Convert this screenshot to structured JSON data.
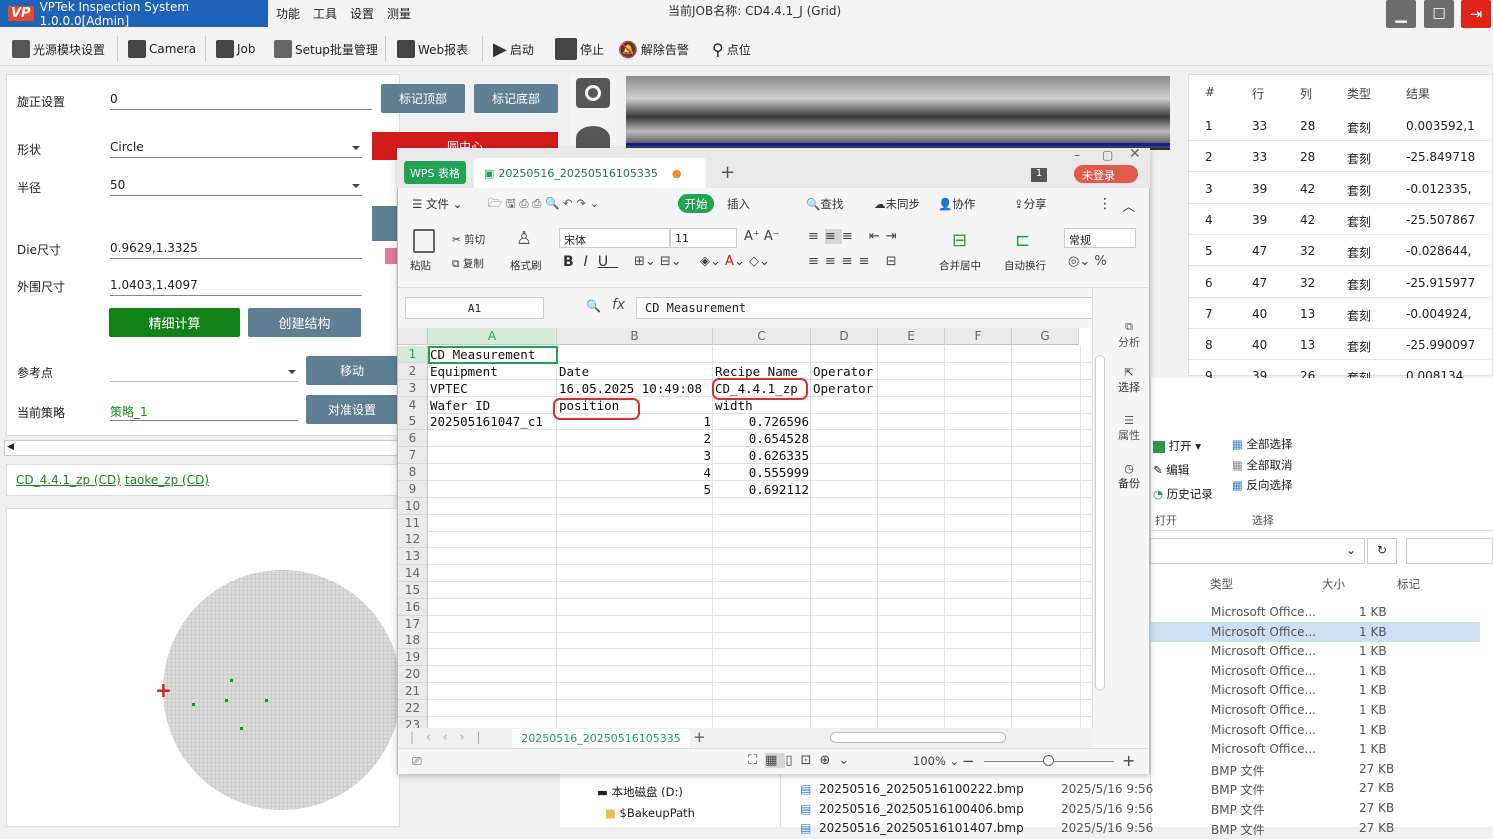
{
  "app": {
    "title": "VPTek Inspection System 1.0.0.0[Admin]",
    "logo": "VP",
    "menu": [
      "功能",
      "工具",
      "设置",
      "测量"
    ],
    "job_label": "当前JOB名称:",
    "job_name": "CD4.4.1_J (Grid)"
  },
  "toolbar": [
    {
      "label": "光源模块设置",
      "icon": "light-icon"
    },
    {
      "label": "Camera",
      "icon": "camera-icon"
    },
    {
      "label": "Job",
      "icon": "briefcase-icon"
    },
    {
      "label": "Setup批量管理",
      "icon": "list-icon"
    },
    {
      "label": "Web报表",
      "icon": "monitor-icon"
    },
    {
      "label": "启动",
      "icon": "play-icon"
    },
    {
      "label": "停止",
      "icon": "stop-icon"
    },
    {
      "label": "解除告警",
      "icon": "bell-off-icon"
    },
    {
      "label": "点位",
      "icon": "pin-icon"
    }
  ],
  "settings": {
    "rotation_label": "旋正设置",
    "rotation_value": "0",
    "mark_top": "标记顶部",
    "mark_bottom": "标记底部",
    "shape_label": "形状",
    "shape_value": "Circle",
    "find_center": "圆中心",
    "radius_label": "半径",
    "radius_value": "50",
    "die_label": "Die尺寸",
    "die_value": "0.9629,1.3325",
    "outer_label": "外围尺寸",
    "outer_value": "1.0403,1.4097",
    "fine_calc": "精细计算",
    "create_struct": "创建结构",
    "ref_label": "参考点",
    "move": "移动",
    "strategy_label": "当前策略",
    "strategy_value": "策略_1",
    "align_settings": "对准设置"
  },
  "cd_tabs": [
    "CD_4.4.1_zp (CD)",
    "taoke_zp (CD)"
  ],
  "results": {
    "headers": [
      "#",
      "行",
      "列",
      "类型",
      "结果"
    ],
    "rows": [
      [
        "1",
        "33",
        "28",
        "套刻",
        "0.003592,1"
      ],
      [
        "2",
        "33",
        "28",
        "套刻",
        "-25.849718"
      ],
      [
        "3",
        "39",
        "42",
        "套刻",
        "-0.012335,"
      ],
      [
        "4",
        "39",
        "42",
        "套刻",
        "-25.507867"
      ],
      [
        "5",
        "47",
        "32",
        "套刻",
        "-0.028644,"
      ],
      [
        "6",
        "47",
        "32",
        "套刻",
        "-25.915977"
      ],
      [
        "7",
        "40",
        "13",
        "套刻",
        "-0.004924,"
      ],
      [
        "8",
        "40",
        "13",
        "套刻",
        "-25.990097"
      ],
      [
        "9",
        "39",
        "26",
        "套刻",
        "0.008134"
      ]
    ]
  },
  "explorer": {
    "ribbon": {
      "open": "打开",
      "edit": "编辑",
      "history": "历史记录",
      "select_all": "全部选择",
      "select_none": "全部取消",
      "invert": "反向选择",
      "group_open": "打开",
      "group_select": "选择"
    },
    "headers": [
      "类型",
      "大小",
      "标记"
    ],
    "rows": [
      [
        "Microsoft Office...",
        "1 KB"
      ],
      [
        "Microsoft Office...",
        "1 KB"
      ],
      [
        "Microsoft Office...",
        "1 KB"
      ],
      [
        "Microsoft Office...",
        "1 KB"
      ],
      [
        "Microsoft Office...",
        "1 KB"
      ],
      [
        "Microsoft Office...",
        "1 KB"
      ],
      [
        "Microsoft Office...",
        "1 KB"
      ],
      [
        "Microsoft Office...",
        "1 KB"
      ],
      [
        "BMP 文件",
        "27 KB"
      ],
      [
        "BMP 文件",
        "27 KB"
      ],
      [
        "BMP 文件",
        "27 KB"
      ],
      [
        "BMP 文件",
        "27 KB"
      ]
    ],
    "files": [
      {
        "name": "20250516_20250516100222.bmp",
        "date": "2025/5/16 9:56"
      },
      {
        "name": "20250516_20250516100406.bmp",
        "date": "2025/5/16 9:56"
      },
      {
        "name": "20250516_20250516101407.bmp",
        "date": "2025/5/16 9:56"
      }
    ],
    "tree": [
      "本地磁盘 (D:)",
      "$BakeupPath"
    ]
  },
  "wps": {
    "app_tab": "WPS 表格",
    "doc_tab": "20250516_20250516105335",
    "badge": "1",
    "login": "未登录",
    "menu": [
      "文件",
      "开始",
      "插入",
      "查找",
      "未同步",
      "协作",
      "分享"
    ],
    "ribbon": {
      "paste": "粘贴",
      "cut": "剪切",
      "copy": "复制",
      "format_painter": "格式刷",
      "font": "宋体",
      "size": "11",
      "merge": "合并居中",
      "wrap": "自动换行",
      "number_format": "常规"
    },
    "namebox": "A1",
    "formula": "CD Measurement",
    "columns": [
      "A",
      "B",
      "C",
      "D",
      "E",
      "F",
      "G"
    ],
    "rows": [
      "1",
      "2",
      "3",
      "4",
      "5",
      "6",
      "7",
      "8",
      "9",
      "10",
      "11",
      "12",
      "13",
      "14",
      "15",
      "16",
      "17",
      "18",
      "19",
      "20",
      "21",
      "22",
      "23"
    ],
    "cells": {
      "A1": "CD Measurement",
      "A2": "Equipment",
      "B2": "Date",
      "C2": "Recipe Name",
      "D2": "Operator",
      "A3": "VPTEC",
      "B3": "16.05.2025 10:49:08",
      "C3": "CD_4.4.1_zp",
      "D3": "Operator",
      "A4": "Wafer ID",
      "B4": "position",
      "C4": "width",
      "A5": "202505161047_c1",
      "B5": "1",
      "C5": "0.726596",
      "B6": "2",
      "C6": "0.654528",
      "B7": "3",
      "C7": "0.626335",
      "B8": "4",
      "C8": "0.555999",
      "B9": "5",
      "C9": "0.692112"
    },
    "sheet_tab": "20250516_20250516105335",
    "zoom": "100%",
    "side": [
      "分析",
      "选择",
      "属性",
      "备份"
    ]
  }
}
